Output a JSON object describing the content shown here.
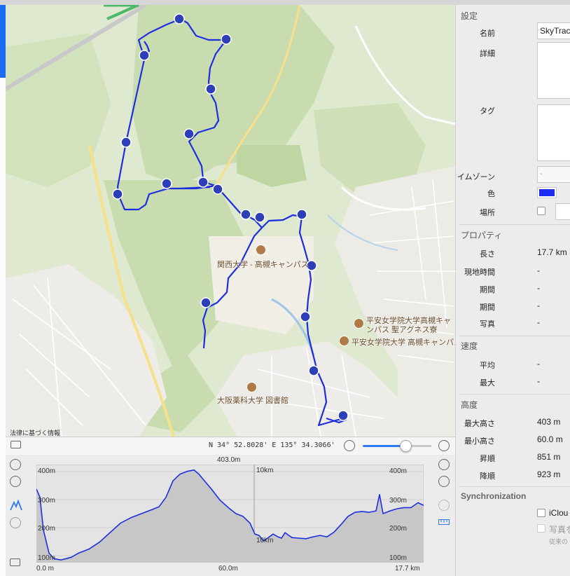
{
  "map": {
    "labels": {
      "kansai": "関西大学 - 高槻キャンパス",
      "heian1": "平安女学院大学高槻キャ",
      "heian1b": "ンパス 聖アグネス寮",
      "heian2": "平安女学院大学 高槻キャンパス",
      "osaka": "大阪薬科大学 図書館"
    },
    "legal": "法律に基づく情報",
    "coordinates": "N 34° 52.8028' E 135° 34.3066'",
    "zoom_level": 0.72
  },
  "elevation": {
    "max_label": "403.0m",
    "y_labels_left": [
      "400m",
      "300m",
      "200m",
      "100m"
    ],
    "y_labels_right": [
      "400m",
      "300m",
      "200m",
      "100m"
    ],
    "x_start": "0.0 m",
    "x_mid": "60.0m",
    "x_end": "17.7 km",
    "mid_km_top": "10km",
    "mid_km_low": "10km"
  },
  "panel": {
    "settings_header": "設定",
    "name_label": "名前",
    "name_value": "SkyTrac",
    "detail_label": "詳細",
    "tag_label": "タグ",
    "timezone_label": "タイムゾーン",
    "timezone_value": "-",
    "color_label": "色",
    "color_value": "#1a2cf0",
    "place_label": "場所",
    "properties_header": "プロパティ",
    "length_label": "長さ",
    "length_value": "17.7 km",
    "localtime_label": "現地時間",
    "localtime_value": "-",
    "period1_label": "期間",
    "period1_value": "-",
    "period2_label": "期間",
    "period2_value": "-",
    "photo_label": "写真",
    "photo_value": "-",
    "speed_header": "速度",
    "avg_label": "平均",
    "avg_value": "-",
    "max_label": "最大",
    "max_value": "-",
    "altitude_header": "高度",
    "maxalt_label": "最大高さ",
    "maxalt_value": "403 m",
    "minalt_label": "最小高さ",
    "minalt_value": "60.0 m",
    "ascent_label": "昇順",
    "ascent_value": "851 m",
    "descent_label": "降順",
    "descent_value": "923 m",
    "sync_header": "Synchronization",
    "icloud_label": "iClou",
    "photo_sync_label": "写真を",
    "photo_sync_note": "従来の"
  }
}
